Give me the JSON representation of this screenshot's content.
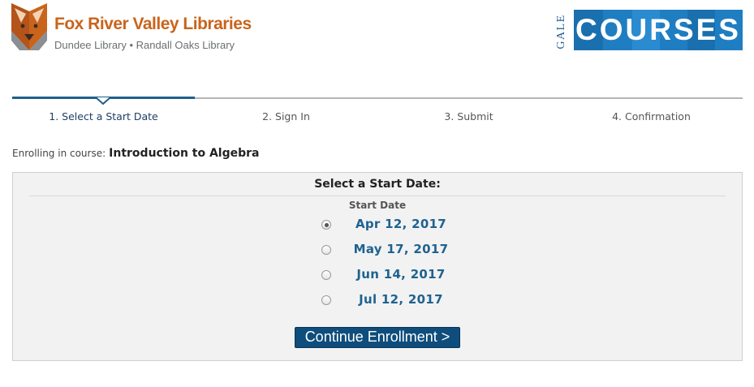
{
  "header": {
    "library_name": "Fox River Valley Libraries",
    "library_branches": "Dundee Library • Randall Oaks Library",
    "brand_small": "GALE",
    "brand_large": "COURSES",
    "colors": {
      "library_orange": "#c9641c",
      "gale_blue": "#1f7ec2"
    }
  },
  "steps": [
    {
      "label": "1. Select a Start Date",
      "active": true
    },
    {
      "label": "2. Sign In",
      "active": false
    },
    {
      "label": "3. Submit",
      "active": false
    },
    {
      "label": "4. Confirmation",
      "active": false
    }
  ],
  "enrollment": {
    "prefix": "Enrolling in course:",
    "course_name": "Introduction to Algebra"
  },
  "panel": {
    "title": "Select a Start Date:",
    "column_header": "Start Date",
    "dates": [
      {
        "label": "Apr 12, 2017",
        "selected": true
      },
      {
        "label": "May 17, 2017",
        "selected": false
      },
      {
        "label": "Jun 14, 2017",
        "selected": false
      },
      {
        "label": "Jul 12, 2017",
        "selected": false
      }
    ],
    "continue_label": "Continue Enrollment >"
  }
}
